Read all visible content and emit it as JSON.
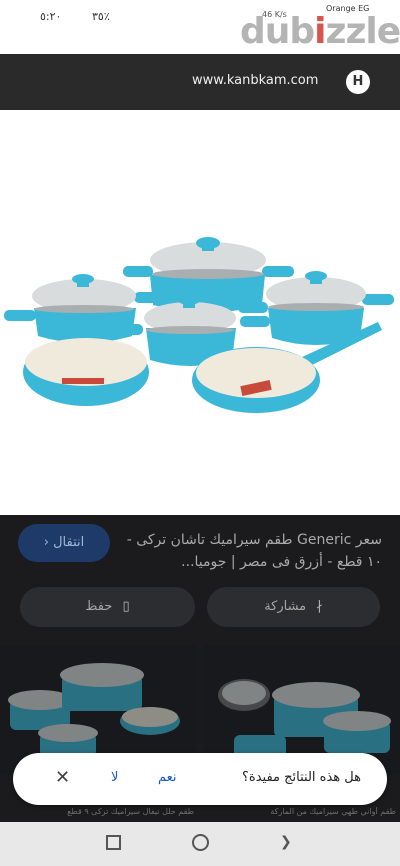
{
  "status": {
    "time": "٥:٢٠",
    "battery": "٣٥٪",
    "carrier": "Orange EG",
    "network": "46  K/s",
    "watermark_pre": "dub",
    "watermark_pin": "i",
    "watermark_post": "zzle"
  },
  "browser": {
    "url": "www.kanbkam.com",
    "favicon_letter": "H"
  },
  "result": {
    "title": "سعر Generic طقم سيراميك تاشان تركى - ١٠ قطع - أزرق فى مصر | جوميا...",
    "visit_label": "انتقال",
    "share_label": "مشاركة",
    "save_label": "حفظ"
  },
  "related": {
    "left_caption": "طقم حلل تيفال سيراميك تركى ٩ قطع",
    "right_caption": "طقم أواني طهي سيراميك من الماركة"
  },
  "feedback": {
    "question": "هل هذه النتائج مفيدة؟",
    "yes": "نعم",
    "no": "لا"
  },
  "colors": {
    "pot_body": "#3bb7d8",
    "pot_lid": "#d9dcdc",
    "pan_inside": "#efeadc",
    "panel_bg": "#1b1b1e"
  }
}
